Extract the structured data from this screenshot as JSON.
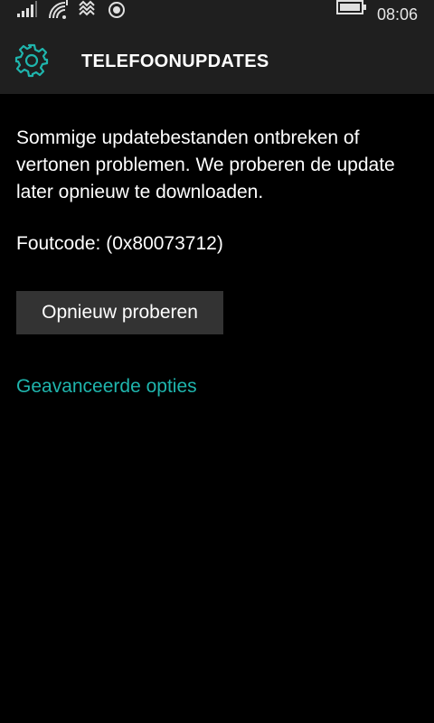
{
  "colors": {
    "background": "#000000",
    "bar_background": "#1f1f1f",
    "accent": "#1fb5ad",
    "button_background": "#333333",
    "text": "#ffffff"
  },
  "status_bar": {
    "icons": [
      "signal-icon",
      "wifi-icon",
      "vibrate-icon",
      "location-icon",
      "battery-icon"
    ],
    "time": "08:06"
  },
  "header": {
    "icon": "gear-icon",
    "title": "TELEFOONUPDATES"
  },
  "main": {
    "message": "Sommige updatebestanden ontbreken of vertonen problemen. We proberen de update later opnieuw te downloaden.",
    "error_code": "Foutcode: (0x80073712)",
    "retry_label": "Opnieuw proberen",
    "advanced_link": "Geavanceerde opties"
  }
}
